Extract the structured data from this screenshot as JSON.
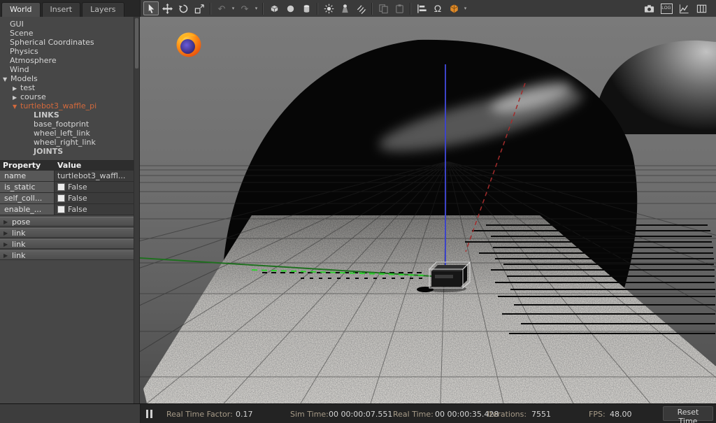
{
  "tabs": {
    "items": [
      "World",
      "Insert",
      "Layers"
    ]
  },
  "toolbar": {
    "log_label": "LOG"
  },
  "sidebar": {
    "tree": [
      {
        "label": "GUI"
      },
      {
        "label": "Scene"
      },
      {
        "label": "Spherical Coordinates"
      },
      {
        "label": "Physics"
      },
      {
        "label": "Atmosphere"
      },
      {
        "label": "Wind"
      },
      {
        "label": "Models"
      },
      {
        "label": "test"
      },
      {
        "label": "course"
      },
      {
        "label": "turtlebot3_waffle_pi"
      },
      {
        "label": "LINKS"
      },
      {
        "label": "base_footprint"
      },
      {
        "label": "wheel_left_link"
      },
      {
        "label": "wheel_right_link"
      },
      {
        "label": "JOINTS"
      }
    ]
  },
  "properties": {
    "header": {
      "property": "Property",
      "value": "Value"
    },
    "rows": [
      {
        "label": "name",
        "value": "turtlebot3_waffl..."
      },
      {
        "label": "is_static",
        "value": "False"
      },
      {
        "label": "self_coll...",
        "value": "False"
      },
      {
        "label": "enable_...",
        "value": "False"
      }
    ],
    "groups": [
      "pose",
      "link",
      "link",
      "link"
    ]
  },
  "statusbar": {
    "real_time_factor_label": "Real Time Factor:",
    "real_time_factor": "0.17",
    "sim_time_label": "Sim Time:",
    "sim_time": "00 00:00:07.551",
    "real_time_label": "Real Time:",
    "real_time": "00 00:00:35.428",
    "iterations_label": "Iterations:",
    "iterations": "7551",
    "fps_label": "FPS:",
    "fps": "48.00",
    "reset_button": "Reset Time"
  },
  "colors": {
    "selected_model": "#d2693c",
    "axis_blue": "#3c43c8",
    "axis_red": "#a32c2c",
    "axis_green_bright": "#2fd42f",
    "view_cube_orange": "#e08a28"
  }
}
